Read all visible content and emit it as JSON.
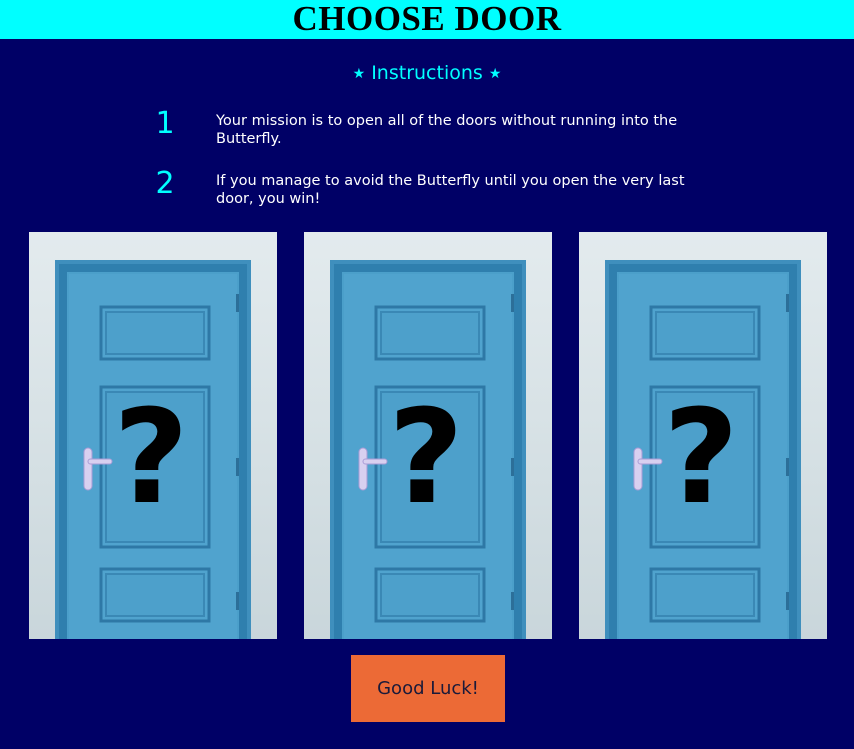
{
  "title": "CHOOSE DOOR",
  "instructions": {
    "heading": "Instructions",
    "star_glyph": "★",
    "steps": [
      {
        "number": "1",
        "text": "Your mission is to open all of the doors without running into the Butterfly."
      },
      {
        "number": "2",
        "text": "If you manage to avoid the Butterfly until you open the very last door, you win!"
      }
    ]
  },
  "doors": [
    {
      "icon": "question-mark-icon",
      "glyph": "?"
    },
    {
      "icon": "question-mark-icon",
      "glyph": "?"
    },
    {
      "icon": "question-mark-icon",
      "glyph": "?"
    }
  ],
  "button": {
    "label": "Good Luck!"
  },
  "colors": {
    "background": "#000066",
    "header": "#00ffff",
    "accent": "#00ffff",
    "door_blue": "#4b9fca",
    "button": "#ec6a36"
  }
}
